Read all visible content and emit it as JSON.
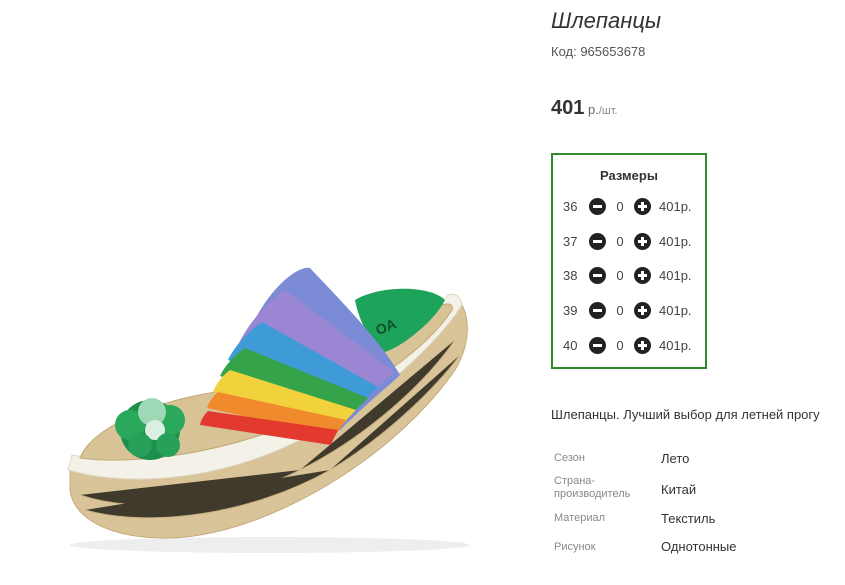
{
  "product": {
    "title": "Шлепанцы",
    "code": "Код: 965653678",
    "price_amount": "401",
    "price_currency": " р.",
    "price_unit": "/шт.",
    "description": "Шлепанцы. Лучший выбор для летней прогу"
  },
  "sizes": {
    "title": "Размеры",
    "rows": [
      {
        "size": "36",
        "qty": "0",
        "price": "401р."
      },
      {
        "size": "37",
        "qty": "0",
        "price": "401р."
      },
      {
        "size": "38",
        "qty": "0",
        "price": "401р."
      },
      {
        "size": "39",
        "qty": "0",
        "price": "401р."
      },
      {
        "size": "40",
        "qty": "0",
        "price": "401р."
      }
    ]
  },
  "attributes": [
    {
      "label": "Сезон",
      "value": "Лето"
    },
    {
      "label_line1": "Страна-",
      "label_line2": "производитель",
      "value": "Китай"
    },
    {
      "label": "Материал",
      "value": "Текстиль"
    },
    {
      "label": "Рисунок",
      "value": "Однотонные"
    }
  ],
  "image": {
    "icon": "sandal-product-photo",
    "insole_brand_text": "OA",
    "colors": {
      "border": "#2f8a2a",
      "insole": "#1ea35a",
      "jute": "#d9c49a",
      "stripes": [
        "#7b8bd6",
        "#9a86d2",
        "#3f9ad8",
        "#35a34a",
        "#f2d23c",
        "#f08a2c",
        "#e23a2e"
      ]
    }
  }
}
